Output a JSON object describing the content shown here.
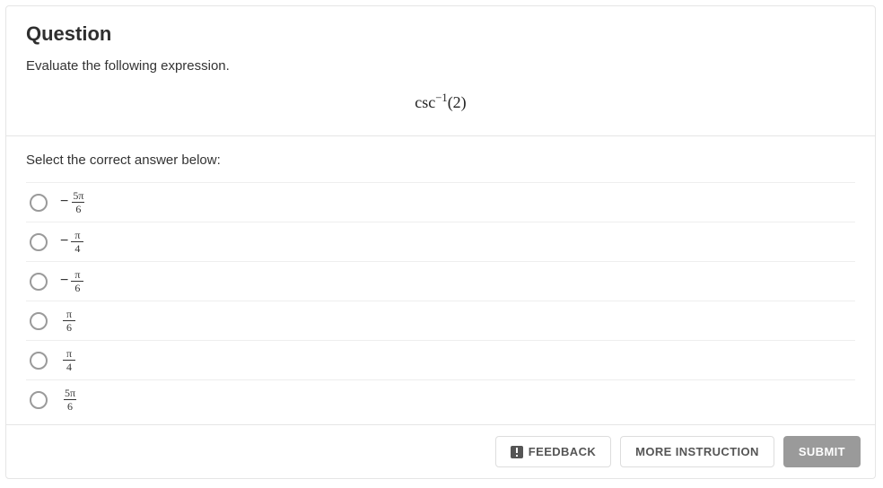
{
  "question": {
    "heading": "Question",
    "prompt": "Evaluate the following expression.",
    "expression": {
      "func": "csc",
      "exponent": "−1",
      "arg": "(2)"
    }
  },
  "answers": {
    "instruction": "Select the correct answer below:",
    "choices": [
      {
        "sign": "−",
        "num": "5π",
        "den": "6"
      },
      {
        "sign": "−",
        "num": "π",
        "den": "4"
      },
      {
        "sign": "−",
        "num": "π",
        "den": "6"
      },
      {
        "sign": "",
        "num": "π",
        "den": "6"
      },
      {
        "sign": "",
        "num": "π",
        "den": "4"
      },
      {
        "sign": "",
        "num": "5π",
        "den": "6"
      }
    ]
  },
  "buttons": {
    "feedback": "FEEDBACK",
    "more_instruction": "MORE INSTRUCTION",
    "submit": "SUBMIT"
  }
}
